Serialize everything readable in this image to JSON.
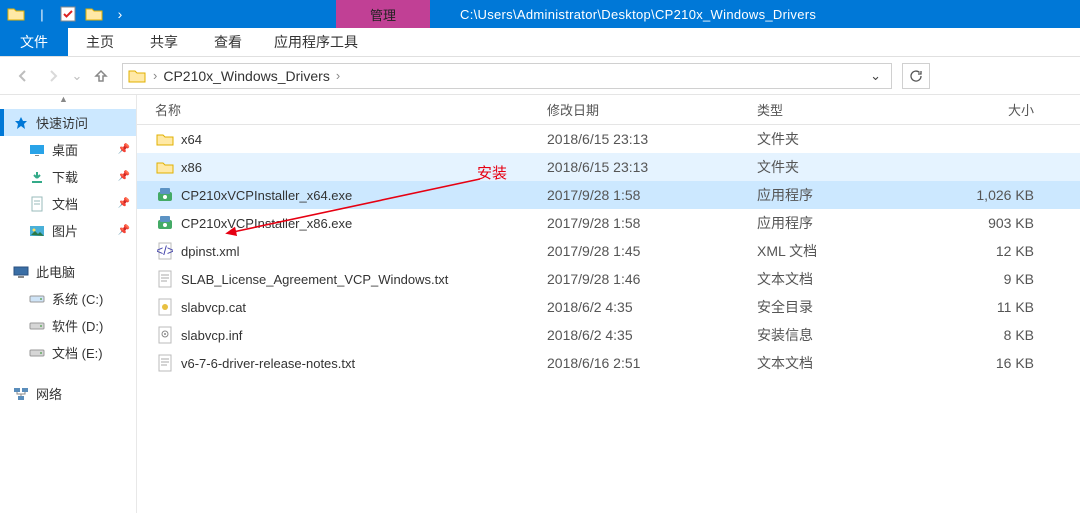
{
  "title_path": "C:\\Users\\Administrator\\Desktop\\CP210x_Windows_Drivers",
  "context_tab": "管理",
  "tabs": {
    "file": "文件",
    "home": "主页",
    "share": "共享",
    "view": "查看",
    "app_tools": "应用程序工具"
  },
  "breadcrumb": "CP210x_Windows_Drivers",
  "columns": {
    "name": "名称",
    "date": "修改日期",
    "type": "类型",
    "size": "大小"
  },
  "sidebar": {
    "quick": "快速访问",
    "items": [
      {
        "label": "桌面",
        "icon": "desktop"
      },
      {
        "label": "下载",
        "icon": "download"
      },
      {
        "label": "文档",
        "icon": "document"
      },
      {
        "label": "图片",
        "icon": "picture"
      }
    ],
    "this_pc": "此电脑",
    "drives": [
      {
        "label": "系统 (C:)"
      },
      {
        "label": "软件 (D:)"
      },
      {
        "label": "文档 (E:)"
      }
    ],
    "network": "网络"
  },
  "files": [
    {
      "name": "x64",
      "date": "2018/6/15 23:13",
      "type": "文件夹",
      "size": "",
      "icon": "folder",
      "state": ""
    },
    {
      "name": "x86",
      "date": "2018/6/15 23:13",
      "type": "文件夹",
      "size": "",
      "icon": "folder",
      "state": "hover"
    },
    {
      "name": "CP210xVCPInstaller_x64.exe",
      "date": "2017/9/28 1:58",
      "type": "应用程序",
      "size": "1,026 KB",
      "icon": "exe",
      "state": "selected"
    },
    {
      "name": "CP210xVCPInstaller_x86.exe",
      "date": "2017/9/28 1:58",
      "type": "应用程序",
      "size": "903 KB",
      "icon": "exe",
      "state": ""
    },
    {
      "name": "dpinst.xml",
      "date": "2017/9/28 1:45",
      "type": "XML 文档",
      "size": "12 KB",
      "icon": "xml",
      "state": ""
    },
    {
      "name": "SLAB_License_Agreement_VCP_Windows.txt",
      "date": "2017/9/28 1:46",
      "type": "文本文档",
      "size": "9 KB",
      "icon": "txt",
      "state": ""
    },
    {
      "name": "slabvcp.cat",
      "date": "2018/6/2 4:35",
      "type": "安全目录",
      "size": "11 KB",
      "icon": "cat",
      "state": ""
    },
    {
      "name": "slabvcp.inf",
      "date": "2018/6/2 4:35",
      "type": "安装信息",
      "size": "8 KB",
      "icon": "inf",
      "state": ""
    },
    {
      "name": "v6-7-6-driver-release-notes.txt",
      "date": "2018/6/16 2:51",
      "type": "文本文档",
      "size": "16 KB",
      "icon": "txt",
      "state": ""
    }
  ],
  "annotation": "安装"
}
